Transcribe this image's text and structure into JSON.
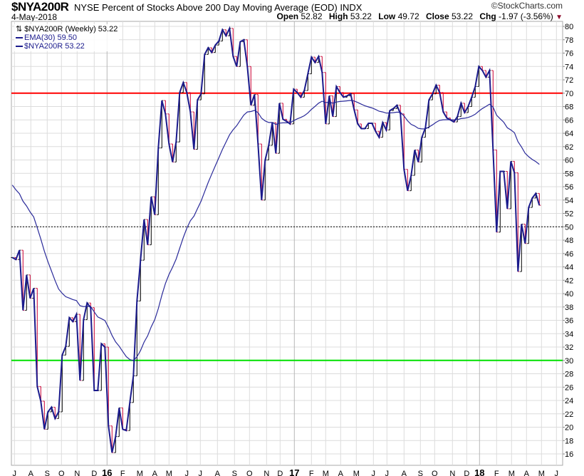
{
  "header": {
    "symbol": "$NYA200R",
    "description": "NYSE Percent of Stocks Above 200 Day Moving Average (EOD)  INDX",
    "date": "4-May-2018",
    "brand": "©StockCharts.com",
    "open_label": "Open",
    "open": "52.82",
    "high_label": "High",
    "high": "53.22",
    "low_label": "Low",
    "low": "49.72",
    "close_label": "Close",
    "close": "53.22",
    "chg_label": "Chg",
    "chg": "-1.97 (-3.56%)",
    "chg_arrow": "▼"
  },
  "legend": {
    "title": "$NYA200R (Weekly) 53.22",
    "ema": "EMA(30) 59.50",
    "series": "$NYA200R 53.22"
  },
  "colors": {
    "price": "#1a1a8c",
    "ema": "#2a2a9a",
    "up_bar": "#000000",
    "down_bar": "#cc0033",
    "upper_line": "#ff0000",
    "lower_line": "#00e000",
    "grid": "#dcdcdc"
  },
  "chart_data": {
    "type": "line",
    "title": "$NYA200R NYSE Percent of Stocks Above 200 Day Moving Average (EOD)",
    "period": "weekly",
    "ylim": [
      14.3,
      80.75
    ],
    "yticks": [
      16,
      18,
      20,
      22,
      24,
      26,
      28,
      30,
      32,
      34,
      36,
      38,
      40,
      42,
      44,
      46,
      48,
      50,
      52,
      54,
      56,
      58,
      60,
      62,
      64,
      66,
      68,
      70,
      72,
      74,
      76,
      78,
      80
    ],
    "reference_lines": [
      {
        "value": 70,
        "color": "#ff0000",
        "style": "solid"
      },
      {
        "value": 50,
        "color": "#000000",
        "style": "dotted"
      },
      {
        "value": 30,
        "color": "#00e000",
        "style": "solid"
      }
    ],
    "ema_period": 30,
    "ema_seed": 57,
    "xticks": [
      {
        "label": "J",
        "week": 0.6
      },
      {
        "label": "A",
        "week": 5.2
      },
      {
        "label": "S",
        "week": 9.8
      },
      {
        "label": "O",
        "week": 13.8
      },
      {
        "label": "N",
        "week": 18.2
      },
      {
        "label": "D",
        "week": 23
      },
      {
        "label": "16",
        "week": 26.6,
        "year": true
      },
      {
        "label": "F",
        "week": 31
      },
      {
        "label": "M",
        "week": 35.8
      },
      {
        "label": "A",
        "week": 40
      },
      {
        "label": "M",
        "week": 44
      },
      {
        "label": "J",
        "week": 49
      },
      {
        "label": "J",
        "week": 52.8
      },
      {
        "label": "A",
        "week": 57.6
      },
      {
        "label": "S",
        "week": 62.4
      },
      {
        "label": "O",
        "week": 66.6
      },
      {
        "label": "N",
        "week": 71.4
      },
      {
        "label": "D",
        "week": 75.2
      },
      {
        "label": "17",
        "week": 79.2,
        "year": true
      },
      {
        "label": "F",
        "week": 84
      },
      {
        "label": "M",
        "week": 88
      },
      {
        "label": "A",
        "week": 92.2
      },
      {
        "label": "M",
        "week": 96.6
      },
      {
        "label": "J",
        "week": 101.4
      },
      {
        "label": "J",
        "week": 105.2
      },
      {
        "label": "A",
        "week": 110
      },
      {
        "label": "S",
        "week": 114.6
      },
      {
        "label": "O",
        "week": 118.6
      },
      {
        "label": "N",
        "week": 123.6
      },
      {
        "label": "D",
        "week": 127.6
      },
      {
        "label": "18",
        "week": 131.2,
        "year": true
      },
      {
        "label": "F",
        "week": 136
      },
      {
        "label": "M",
        "week": 140.2
      },
      {
        "label": "A",
        "week": 144.4
      },
      {
        "label": "M",
        "week": 148.6
      },
      {
        "label": "J",
        "week": 152.8
      }
    ],
    "close": [
      45.4,
      45.1,
      46.5,
      37.5,
      42.8,
      39.3,
      40.8,
      26.1,
      23.9,
      19.7,
      22.3,
      23.0,
      21.3,
      22.3,
      30.8,
      32.1,
      36.4,
      35.8,
      36.9,
      27.0,
      36.1,
      38.6,
      37.9,
      25.5,
      25.5,
      32.5,
      32.0,
      20.2,
      16.2,
      18.6,
      22.9,
      19.7,
      19.5,
      23.7,
      27.7,
      38.9,
      45.0,
      51.1,
      47.3,
      54.5,
      51.8,
      61.8,
      68.9,
      66.9,
      62.4,
      59.7,
      62.7,
      70.1,
      71.6,
      70.1,
      67.2,
      61.6,
      69.0,
      69.9,
      75.8,
      76.8,
      76.1,
      77.2,
      77.8,
      79.5,
      78.6,
      79.7,
      75.5,
      74.0,
      77.7,
      78.0,
      74.0,
      68.2,
      69.8,
      62.4,
      54.0,
      60.0,
      62.2,
      65.6,
      61.0,
      68.5,
      66.1,
      65.8,
      65.4,
      70.6,
      70.1,
      69.4,
      70.4,
      72.9,
      75.4,
      74.6,
      75.5,
      73.1,
      65.4,
      69.6,
      66.5,
      71.0,
      70.1,
      69.4,
      69.6,
      69.9,
      67.5,
      65.4,
      64.7,
      64.7,
      65.5,
      65.5,
      64.3,
      63.4,
      65.6,
      64.5,
      67.4,
      67.7,
      68.2,
      66.9,
      58.6,
      55.4,
      57.7,
      61.5,
      59.7,
      63.4,
      64.8,
      69.0,
      69.9,
      71.2,
      70.1,
      67.2,
      66.3,
      66.0,
      65.7,
      66.5,
      68.5,
      67.1,
      68.0,
      69.4,
      71.0,
      74.0,
      73.4,
      72.4,
      73.4,
      61.5,
      49.2,
      58.3,
      58.3,
      52.7,
      59.8,
      58.1,
      43.3,
      50.4,
      47.5,
      52.9,
      54.3,
      55.0,
      53.22
    ]
  }
}
